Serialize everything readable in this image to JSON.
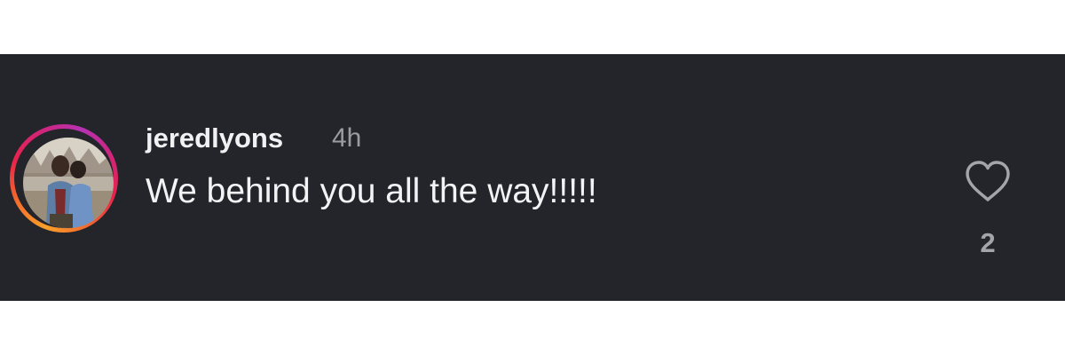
{
  "comment": {
    "username": "jeredlyons",
    "timestamp": "4h",
    "text": "We behind you all the way!!!!!",
    "like_count": "2"
  },
  "icons": {
    "like": "heart-outline-icon",
    "story_ring": "gradient-story-ring"
  },
  "colors": {
    "panel_background": "#24252a",
    "primary_text": "#f1f1f3",
    "secondary_text": "#9b9ca3",
    "ring_gradient": [
      "#f9a02b",
      "#e8234b",
      "#b632b2"
    ]
  }
}
